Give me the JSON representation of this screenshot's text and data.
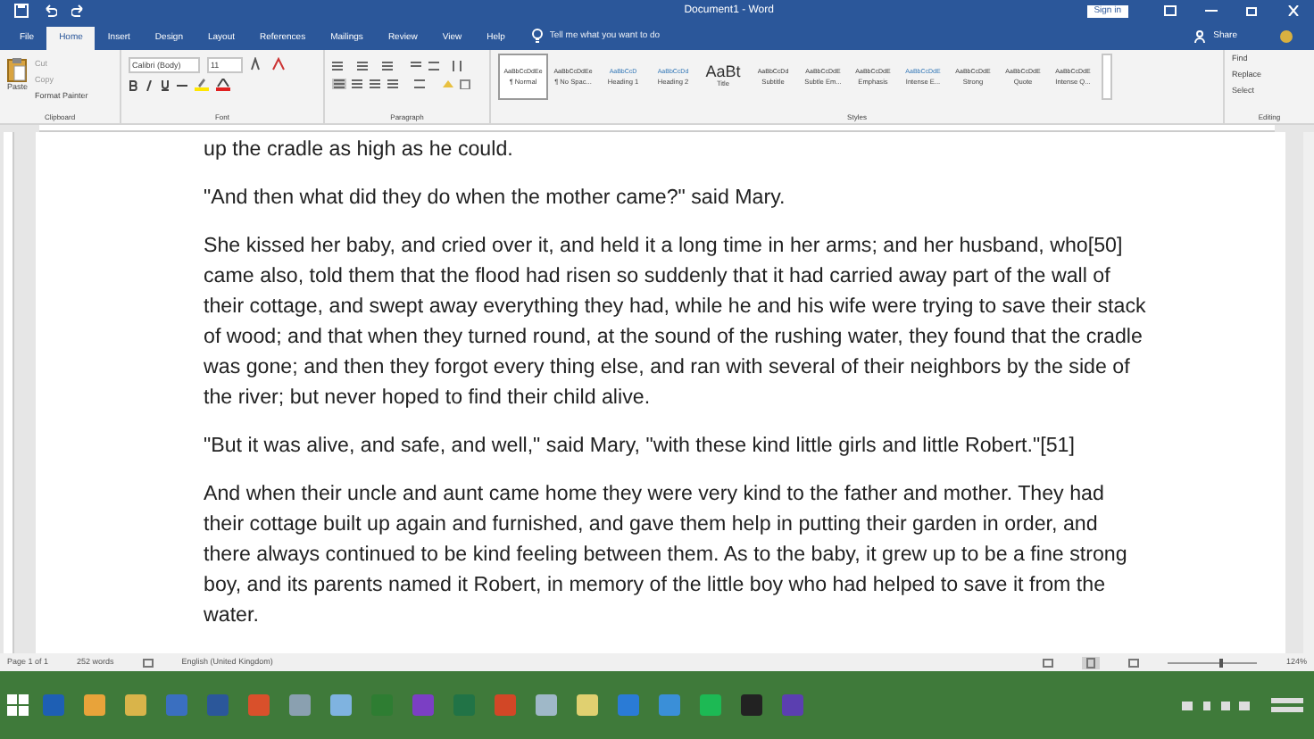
{
  "window": {
    "title": "Document1 - Word",
    "sign_in": "Sign in",
    "share": "Share"
  },
  "tabs": [
    {
      "label": "File",
      "selected": false
    },
    {
      "label": "Home",
      "selected": true
    },
    {
      "label": "Insert",
      "selected": false
    },
    {
      "label": "Design",
      "selected": false
    },
    {
      "label": "Layout",
      "selected": false
    },
    {
      "label": "References",
      "selected": false
    },
    {
      "label": "Mailings",
      "selected": false
    },
    {
      "label": "Review",
      "selected": false
    },
    {
      "label": "View",
      "selected": false
    },
    {
      "label": "Help",
      "selected": false
    }
  ],
  "tell_me": {
    "placeholder": "Tell me what you want to do"
  },
  "clipboard": {
    "paste": "Paste",
    "cut": "Cut",
    "copy": "Copy",
    "format_painter": "Format Painter",
    "label": "Clipboard"
  },
  "font": {
    "name": "Calibri (Body)",
    "size": "11",
    "label": "Font"
  },
  "paragraph": {
    "label": "Paragraph"
  },
  "styles": {
    "label": "Styles",
    "items": [
      {
        "preview": "AaBbCcDdEe",
        "name": "¶ Normal",
        "selected": true
      },
      {
        "preview": "AaBbCcDdEe",
        "name": "¶ No Spac...",
        "selected": false
      },
      {
        "preview": "AaBbCcD",
        "name": "Heading 1",
        "selected": false
      },
      {
        "preview": "AaBbCcDd",
        "name": "Heading 2",
        "selected": false
      },
      {
        "preview": "AaBt",
        "name": "Title",
        "selected": false
      },
      {
        "preview": "AaBbCcDd",
        "name": "Subtitle",
        "selected": false
      },
      {
        "preview": "AaBbCcDdE",
        "name": "Subtle Em...",
        "selected": false
      },
      {
        "preview": "AaBbCcDdE",
        "name": "Emphasis",
        "selected": false
      },
      {
        "preview": "AaBbCcDdE",
        "name": "Intense E...",
        "selected": false
      },
      {
        "preview": "AaBbCcDdE",
        "name": "Strong",
        "selected": false
      },
      {
        "preview": "AaBbCcDdE",
        "name": "Quote",
        "selected": false
      },
      {
        "preview": "AaBbCcDdE",
        "name": "Intense Q...",
        "selected": false
      }
    ]
  },
  "editing": {
    "label": "Editing",
    "items": [
      "Find",
      "Replace",
      "Select"
    ]
  },
  "document": {
    "paragraphs": [
      "up the cradle as high as he could.",
      "\"And then what did they do when the mother came?\" said Mary.",
      "She kissed her baby, and cried over it, and held it a long time in her arms; and her husband, who[50] came also, told them that the flood had risen so suddenly that it had carried away part of the wall of their cottage, and swept away everything they had, while he and his wife were trying to save their stack of wood; and that when they turned round, at the sound of the rushing water, they found that the cradle was gone; and then they forgot every thing else, and ran with several of their neighbors by the side of the river; but never hoped to find their child alive.",
      "\"But it was alive, and safe, and well,\" said Mary, \"with these kind little girls and little Robert.\"[51]",
      "And when their uncle and aunt came home they were very kind to the father and mother. They had their cottage built up again and furnished, and gave them help in putting their garden in order, and there always continued to be kind feeling between them. As to the baby, it grew up to be a fine strong boy, and its parents named it Robert, in memory of the little boy who had helped to save it from the water."
    ]
  },
  "status_bar": {
    "page": "Page 1 of 1",
    "words": "252 words",
    "language": "English (United Kingdom)",
    "zoom": "124%",
    "zoom_slider": {
      "level": 0.6
    }
  },
  "taskbar": {
    "apps": [
      {
        "color": "#1e5fb4"
      },
      {
        "color": "#e8a33a"
      },
      {
        "color": "#d9b44a"
      },
      {
        "color": "#3a6fc0"
      },
      {
        "color": "#2b579a"
      },
      {
        "color": "#d9502b"
      },
      {
        "color": "#8aa0b0"
      },
      {
        "color": "#7fb3e0"
      },
      {
        "color": "#2e7d32"
      },
      {
        "color": "#7b3fc4"
      },
      {
        "color": "#217346"
      },
      {
        "color": "#d24726"
      },
      {
        "color": "#9fb8c8"
      },
      {
        "color": "#e0d070"
      },
      {
        "color": "#2a7bd6"
      },
      {
        "color": "#3a8fd8"
      },
      {
        "color": "#1db954"
      },
      {
        "color": "#222222"
      },
      {
        "color": "#5b3fb0"
      }
    ]
  }
}
